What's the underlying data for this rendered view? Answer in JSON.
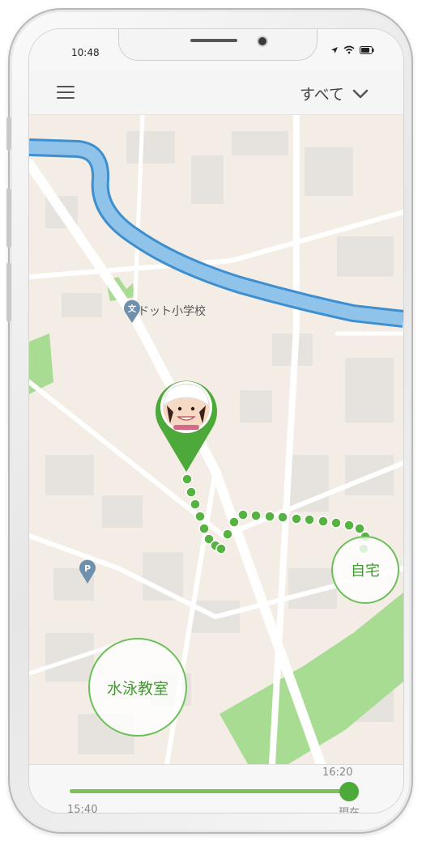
{
  "status_bar": {
    "time": "10:48",
    "icons": [
      "location-arrow-icon",
      "wifi-icon",
      "battery-icon"
    ]
  },
  "header": {
    "menu_icon": "hamburger-menu-icon",
    "filter_label": "すべて",
    "filter_icon": "chevron-down-icon"
  },
  "map": {
    "school_label": "ドット小学校",
    "school_icon": "school-pin-icon",
    "school_icon_glyph": "文",
    "parking_icon": "parking-pin-icon",
    "parking_glyph": "P",
    "child_marker_icon": "child-avatar-pin",
    "places": [
      {
        "label": "自宅"
      },
      {
        "label": "水泳教室"
      }
    ]
  },
  "timeline": {
    "start_time": "15:40",
    "end_time": "16:20",
    "now_label": "現在",
    "progress": 1.0
  },
  "colors": {
    "accent_green": "#4ca93a",
    "route_green": "#56b341",
    "river_blue": "#8fc3ea",
    "park_green": "#9fd98a"
  }
}
